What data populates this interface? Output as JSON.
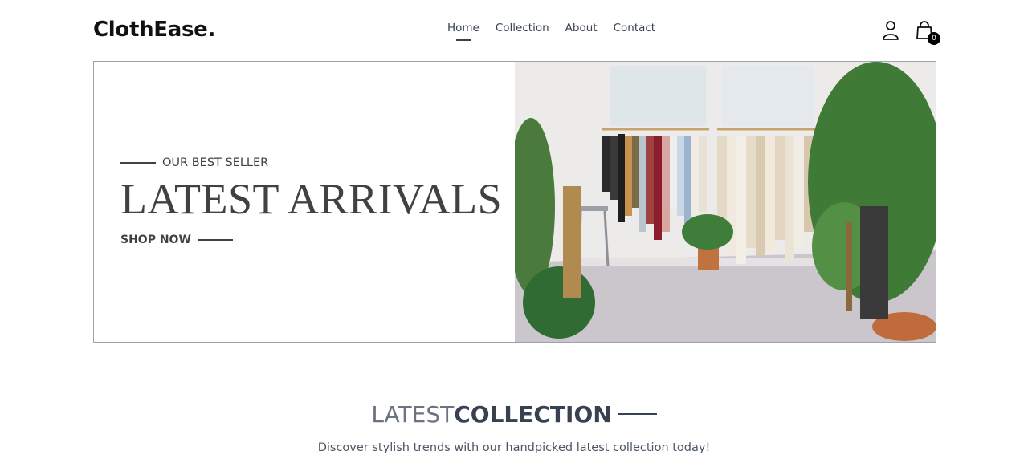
{
  "brand": {
    "name": "ClothEase",
    "dot": "."
  },
  "nav": {
    "links": [
      {
        "label": "Home",
        "active": true
      },
      {
        "label": "Collection",
        "active": false
      },
      {
        "label": "About",
        "active": false
      },
      {
        "label": "Contact",
        "active": false
      }
    ],
    "cart_count": "0",
    "icons": [
      "profile-icon",
      "cart-icon"
    ]
  },
  "hero": {
    "subtitle": "OUR BEST SELLER",
    "title": "LATEST ARRIVALS",
    "cta": "SHOP NOW",
    "image": "clothing-store-photo"
  },
  "latest_collection": {
    "title_light": "LATEST",
    "title_dark": "COLLECTION",
    "description": "Discover stylish trends with our handpicked latest collection today!"
  },
  "colors": {
    "text_dark": "#414141",
    "accent_black": "#000000",
    "border": "#9ca3af"
  }
}
